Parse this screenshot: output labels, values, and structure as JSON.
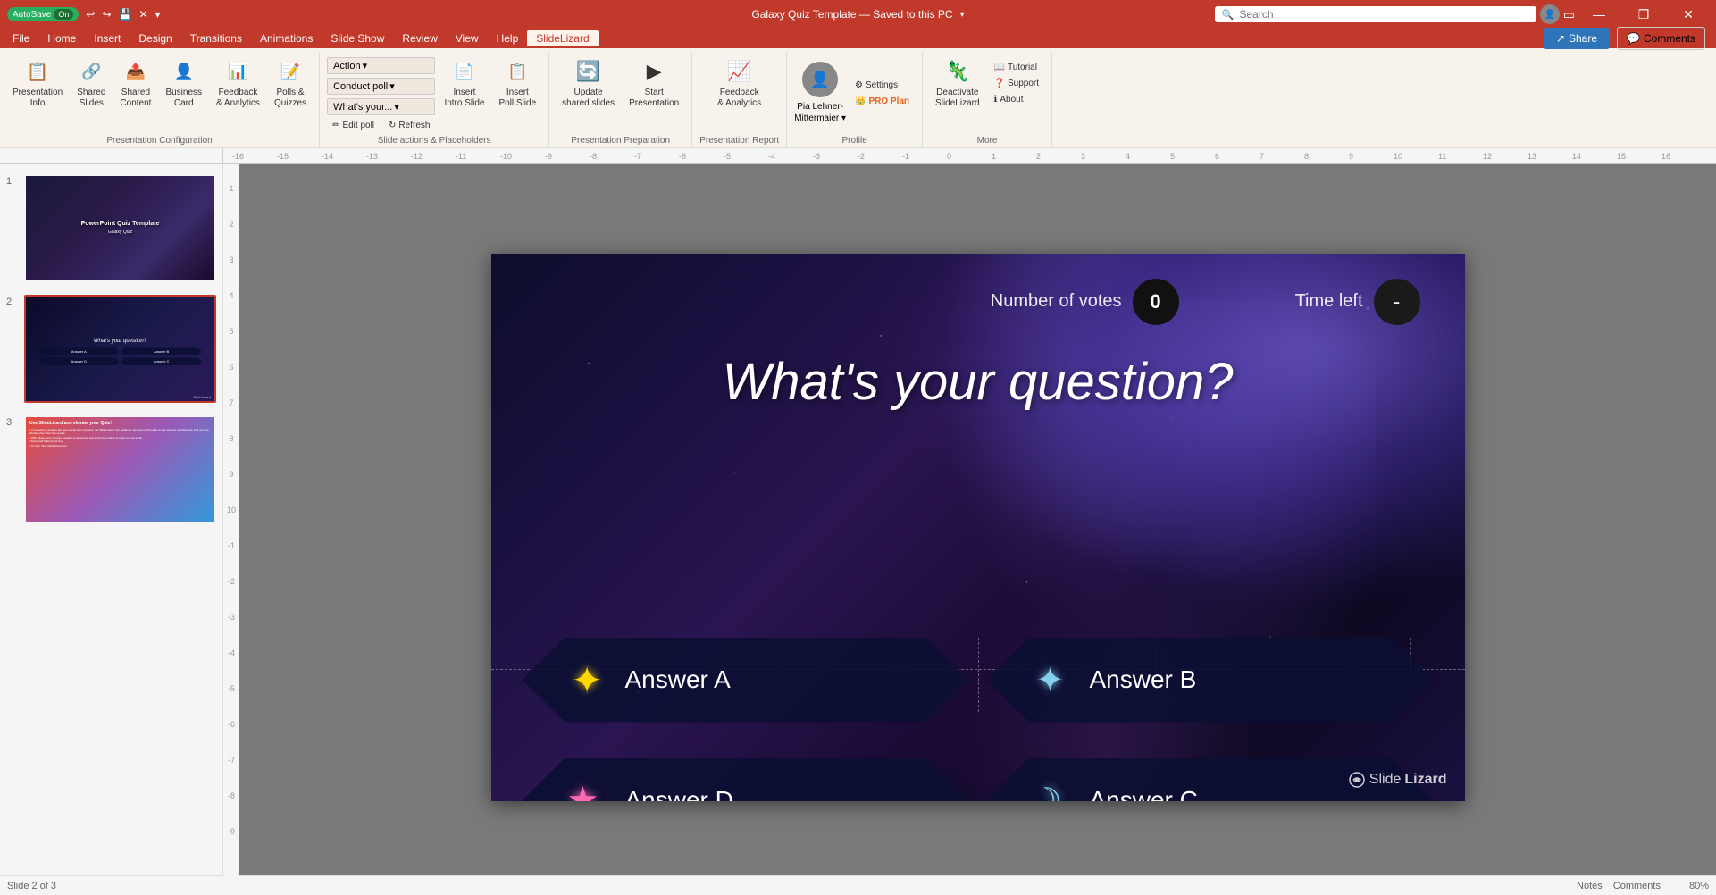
{
  "titleBar": {
    "autosave": "AutoSave",
    "autosave_status": "On",
    "title": "Galaxy Quiz Template — Saved to this PC",
    "search_placeholder": "Search",
    "btn_minimize": "—",
    "btn_restore": "❐",
    "btn_close": "✕"
  },
  "menuBar": {
    "items": [
      {
        "id": "file",
        "label": "File"
      },
      {
        "id": "home",
        "label": "Home"
      },
      {
        "id": "insert",
        "label": "Insert"
      },
      {
        "id": "design",
        "label": "Design"
      },
      {
        "id": "transitions",
        "label": "Transitions"
      },
      {
        "id": "animations",
        "label": "Animations"
      },
      {
        "id": "slideshow",
        "label": "Slide Show"
      },
      {
        "id": "review",
        "label": "Review"
      },
      {
        "id": "view",
        "label": "View"
      },
      {
        "id": "help",
        "label": "Help"
      },
      {
        "id": "slidelizard",
        "label": "SlideLizard",
        "active": true
      }
    ]
  },
  "ribbon": {
    "groups": [
      {
        "id": "presentation-config",
        "label": "Presentation Configuration",
        "items": [
          {
            "id": "pres-info",
            "icon": "📋",
            "label": "Presentation\nInfo"
          },
          {
            "id": "shared-slides",
            "icon": "🔗",
            "label": "Shared\nSlides"
          },
          {
            "id": "shared-content",
            "icon": "📤",
            "label": "Shared\nContent"
          },
          {
            "id": "business-card",
            "icon": "👤",
            "label": "Business\nCard"
          },
          {
            "id": "feedback",
            "icon": "📊",
            "label": "Feedback\n& Analytics"
          },
          {
            "id": "polls",
            "icon": "📝",
            "label": "Polls &\nQuizzes"
          }
        ]
      },
      {
        "id": "slide-actions",
        "label": "Slide actions & Placeholders",
        "dropdown_action": "Action",
        "dropdown_poll": "Conduct poll",
        "dropdown_what": "What's your...",
        "btn_edit": "Edit poll",
        "btn_refresh": "Refresh",
        "btn_insert_intro": "Insert\nIntro Slide",
        "btn_insert_poll": "Insert\nPoll Slide"
      },
      {
        "id": "pres-prep",
        "label": "Presentation Preparation",
        "btn_update": "Update\nshared slides",
        "btn_start": "Start\nPresentation"
      },
      {
        "id": "pres-report",
        "label": "Presentation Report",
        "btn_feedback": "Feedback\n& Analytics"
      },
      {
        "id": "profile",
        "label": "Profile",
        "name": "Pia Lehner-\nMittermaier",
        "btn_settings": "Settings",
        "btn_pro": "PRO Plan"
      },
      {
        "id": "more",
        "label": "More",
        "btn_deactivate": "Deactivate\nSlideLizard",
        "btn_tutorial": "Tutorial",
        "btn_support": "Support",
        "btn_about": "About"
      }
    ],
    "share_label": "Share",
    "comments_label": "Comments"
  },
  "slides": [
    {
      "num": "1",
      "title": "PowerPoint Quiz Template\nGalaxy Quiz"
    },
    {
      "num": "2",
      "title": "What's your question?",
      "active": true
    },
    {
      "num": "3",
      "title": "Use SlideLizard slide"
    }
  ],
  "canvas": {
    "votes_label": "Number of votes",
    "votes_value": "0",
    "time_label": "Time left",
    "time_value": "-",
    "question": "What's your question?",
    "answers": [
      {
        "id": "A",
        "text": "Answer A",
        "icon": "☀",
        "icon_color": "#FFD700"
      },
      {
        "id": "B",
        "text": "Answer B",
        "icon": "✦",
        "icon_color": "#87CEEB"
      },
      {
        "id": "D",
        "text": "Answer D",
        "icon": "★",
        "icon_color": "#FF69B4"
      },
      {
        "id": "C",
        "text": "Answer C",
        "icon": "☾",
        "icon_color": "#87CEEB"
      }
    ],
    "watermark": "SlideLizard"
  },
  "statusBar": {
    "slide_info": "Slide 2 of 3",
    "notes": "Notes",
    "comments": "Comments",
    "zoom": "80%"
  }
}
